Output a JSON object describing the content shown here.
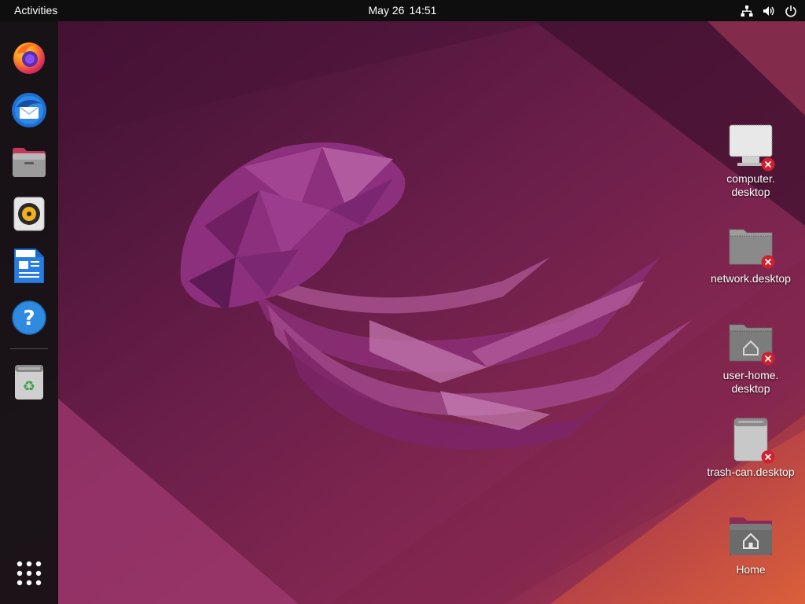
{
  "topbar": {
    "activities_label": "Activities",
    "date": "May 26",
    "time": "14:51",
    "status_icons": [
      "network-wired-icon",
      "volume-icon",
      "power-icon"
    ]
  },
  "dock": {
    "apps": [
      {
        "name": "Firefox",
        "icon": "firefox-icon"
      },
      {
        "name": "Thunderbird Mail",
        "icon": "thunderbird-icon"
      },
      {
        "name": "Files",
        "icon": "files-icon"
      },
      {
        "name": "Rhythmbox",
        "icon": "rhythmbox-icon"
      },
      {
        "name": "LibreOffice Writer",
        "icon": "libreoffice-writer-icon"
      },
      {
        "name": "Help",
        "icon": "help-icon"
      },
      {
        "name": "Trash",
        "icon": "trash-icon"
      }
    ],
    "show_apps_icon": "app-grid-icon"
  },
  "desktop": {
    "icons": [
      {
        "label": "computer.\ndesktop",
        "icon": "computer-icon",
        "broken": true
      },
      {
        "label": "network.desktop",
        "icon": "network-folder-icon",
        "broken": true
      },
      {
        "label": "user-home.\ndesktop",
        "icon": "user-home-icon",
        "broken": true
      },
      {
        "label": "trash-can.desktop",
        "icon": "trash-can-icon",
        "broken": true
      },
      {
        "label": "Home",
        "icon": "home-folder-icon",
        "broken": false
      }
    ]
  },
  "colors": {
    "topbar": "#0e0e0e",
    "dock": "#141214",
    "wallpaper_dark": "#4a1336",
    "wallpaper_mid": "#7d2253",
    "wallpaper_accent": "#c84a3a",
    "jellyfish": "#9a3c8a",
    "error_badge": "#d0202e"
  }
}
